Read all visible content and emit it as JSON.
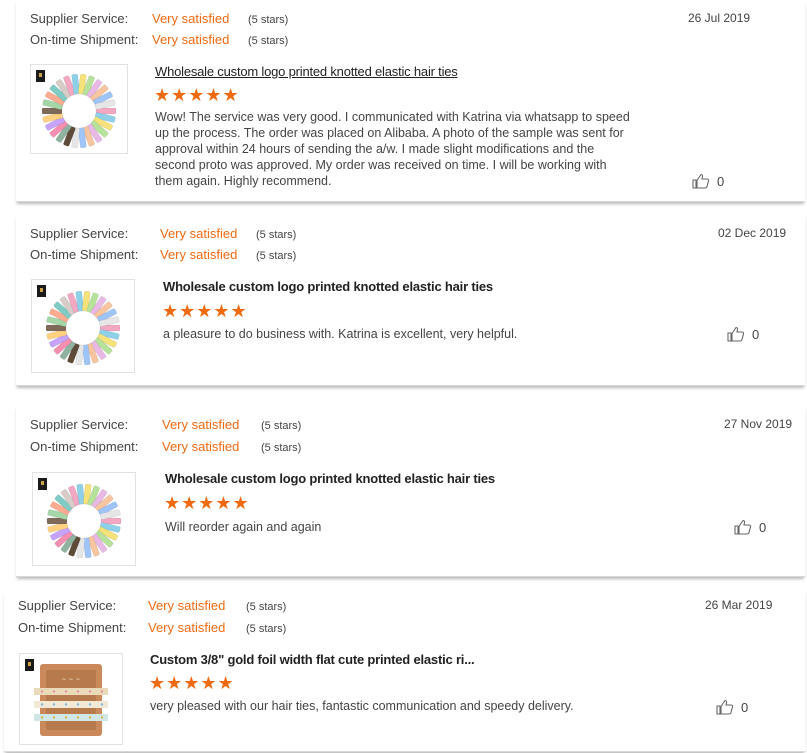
{
  "reviews": [
    {
      "supplier_label": "Supplier Service:",
      "supplier_value": "Very satisfied",
      "supplier_stars": "(5 stars)",
      "shipment_label": "On-time Shipment:",
      "shipment_value": "Very satisfied",
      "shipment_stars": "(5 stars)",
      "date": "26 Jul 2019",
      "product_title": "Wholesale custom logo printed knotted elastic hair ties",
      "rating_stars": "★★★★★",
      "text": "Wow!  The service was very good.  I communicated with Katrina via whatsapp to speed up the process.  The order was placed on Alibaba.  A photo of the sample was sent for approval within 24 hours of sending the a/w.  I made slight modifications and the second proto was approved.  My order was received on time.  I will be working with them again.  Highly recommend.",
      "likes": "0",
      "image": "hair-ties-wreath"
    },
    {
      "supplier_label": "Supplier Service:",
      "supplier_value": "Very satisfied",
      "supplier_stars": "(5 stars)",
      "shipment_label": "On-time Shipment:",
      "shipment_value": "Very satisfied",
      "shipment_stars": "(5 stars)",
      "date": "02 Dec 2019",
      "product_title": "Wholesale custom logo printed knotted elastic hair ties",
      "rating_stars": "★★★★★",
      "text": "a pleasure to do business with. Katrina is excellent, very helpful.",
      "likes": "0",
      "image": "hair-ties-wreath"
    },
    {
      "supplier_label": "Supplier Service:",
      "supplier_value": "Very satisfied",
      "supplier_stars": "(5 stars)",
      "shipment_label": "On-time Shipment:",
      "shipment_value": "Very satisfied",
      "shipment_stars": "(5 stars)",
      "date": "27 Nov 2019",
      "product_title": "Wholesale custom logo printed knotted elastic hair ties",
      "rating_stars": "★★★★★",
      "text": "Will reorder again and again",
      "likes": "0",
      "image": "hair-ties-wreath"
    },
    {
      "supplier_label": "Supplier Service:",
      "supplier_value": "Very satisfied",
      "supplier_stars": "(5 stars)",
      "shipment_label": "On-time Shipment:",
      "shipment_value": "Very satisfied",
      "shipment_stars": "(5 stars)",
      "date": "26 Mar 2019",
      "product_title": "Custom 3/8\" gold foil width flat cute printed elastic ri...",
      "rating_stars": "★★★★★",
      "text": "very pleased with our hair ties, fantastic communication and speedy delivery.",
      "likes": "0",
      "image": "hair-ties-card"
    }
  ],
  "colors": {
    "accent": "#f06a12",
    "text": "#444444"
  }
}
